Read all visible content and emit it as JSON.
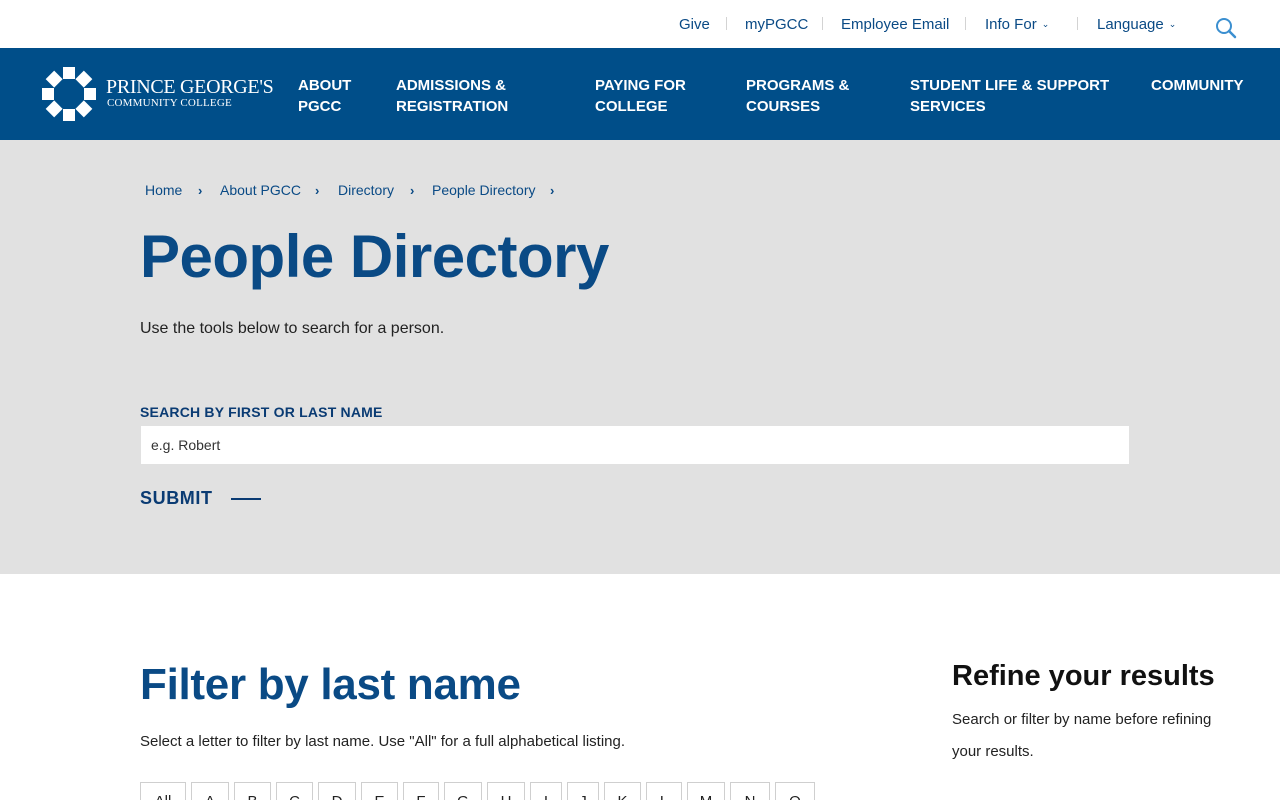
{
  "utility": {
    "links": [
      "Give",
      "myPGCC",
      "Employee Email",
      "Info For",
      "Language"
    ]
  },
  "logo": {
    "line1": "PRINCE GEORGE'S",
    "line2": "COMMUNITY COLLEGE"
  },
  "nav": {
    "items": [
      [
        "ABOUT",
        "PGCC"
      ],
      [
        "ADMISSIONS &",
        "REGISTRATION"
      ],
      [
        "PAYING FOR",
        "COLLEGE"
      ],
      [
        "PROGRAMS &",
        "COURSES"
      ],
      [
        "STUDENT LIFE & SUPPORT",
        "SERVICES"
      ],
      [
        "COMMUNITY"
      ]
    ]
  },
  "breadcrumb": [
    "Home",
    "About PGCC",
    "Directory",
    "People Directory"
  ],
  "hero": {
    "title": "People Directory",
    "intro": "Use the tools below to search for a person.",
    "search_label": "SEARCH BY FIRST OR LAST NAME",
    "search_placeholder": "e.g. Robert",
    "submit": "SUBMIT"
  },
  "filter": {
    "title": "Filter by last name",
    "description": "Select a letter to filter by last name. Use \"All\" for a full alphabetical listing.",
    "letters": [
      "All",
      "A",
      "B",
      "C",
      "D",
      "E",
      "F",
      "G",
      "H",
      "I",
      "J",
      "K",
      "L",
      "M",
      "N",
      "O"
    ]
  },
  "refine": {
    "title": "Refine your results",
    "description": "Search or filter by name before refining your results."
  },
  "colors": {
    "brand_blue": "#004e89",
    "link_blue": "#0a4a85",
    "hero_gray": "#e1e1e1"
  },
  "icons": [
    "logo-mark-icon",
    "search-icon",
    "chevron-down-icon",
    "chevron-right-icon"
  ]
}
